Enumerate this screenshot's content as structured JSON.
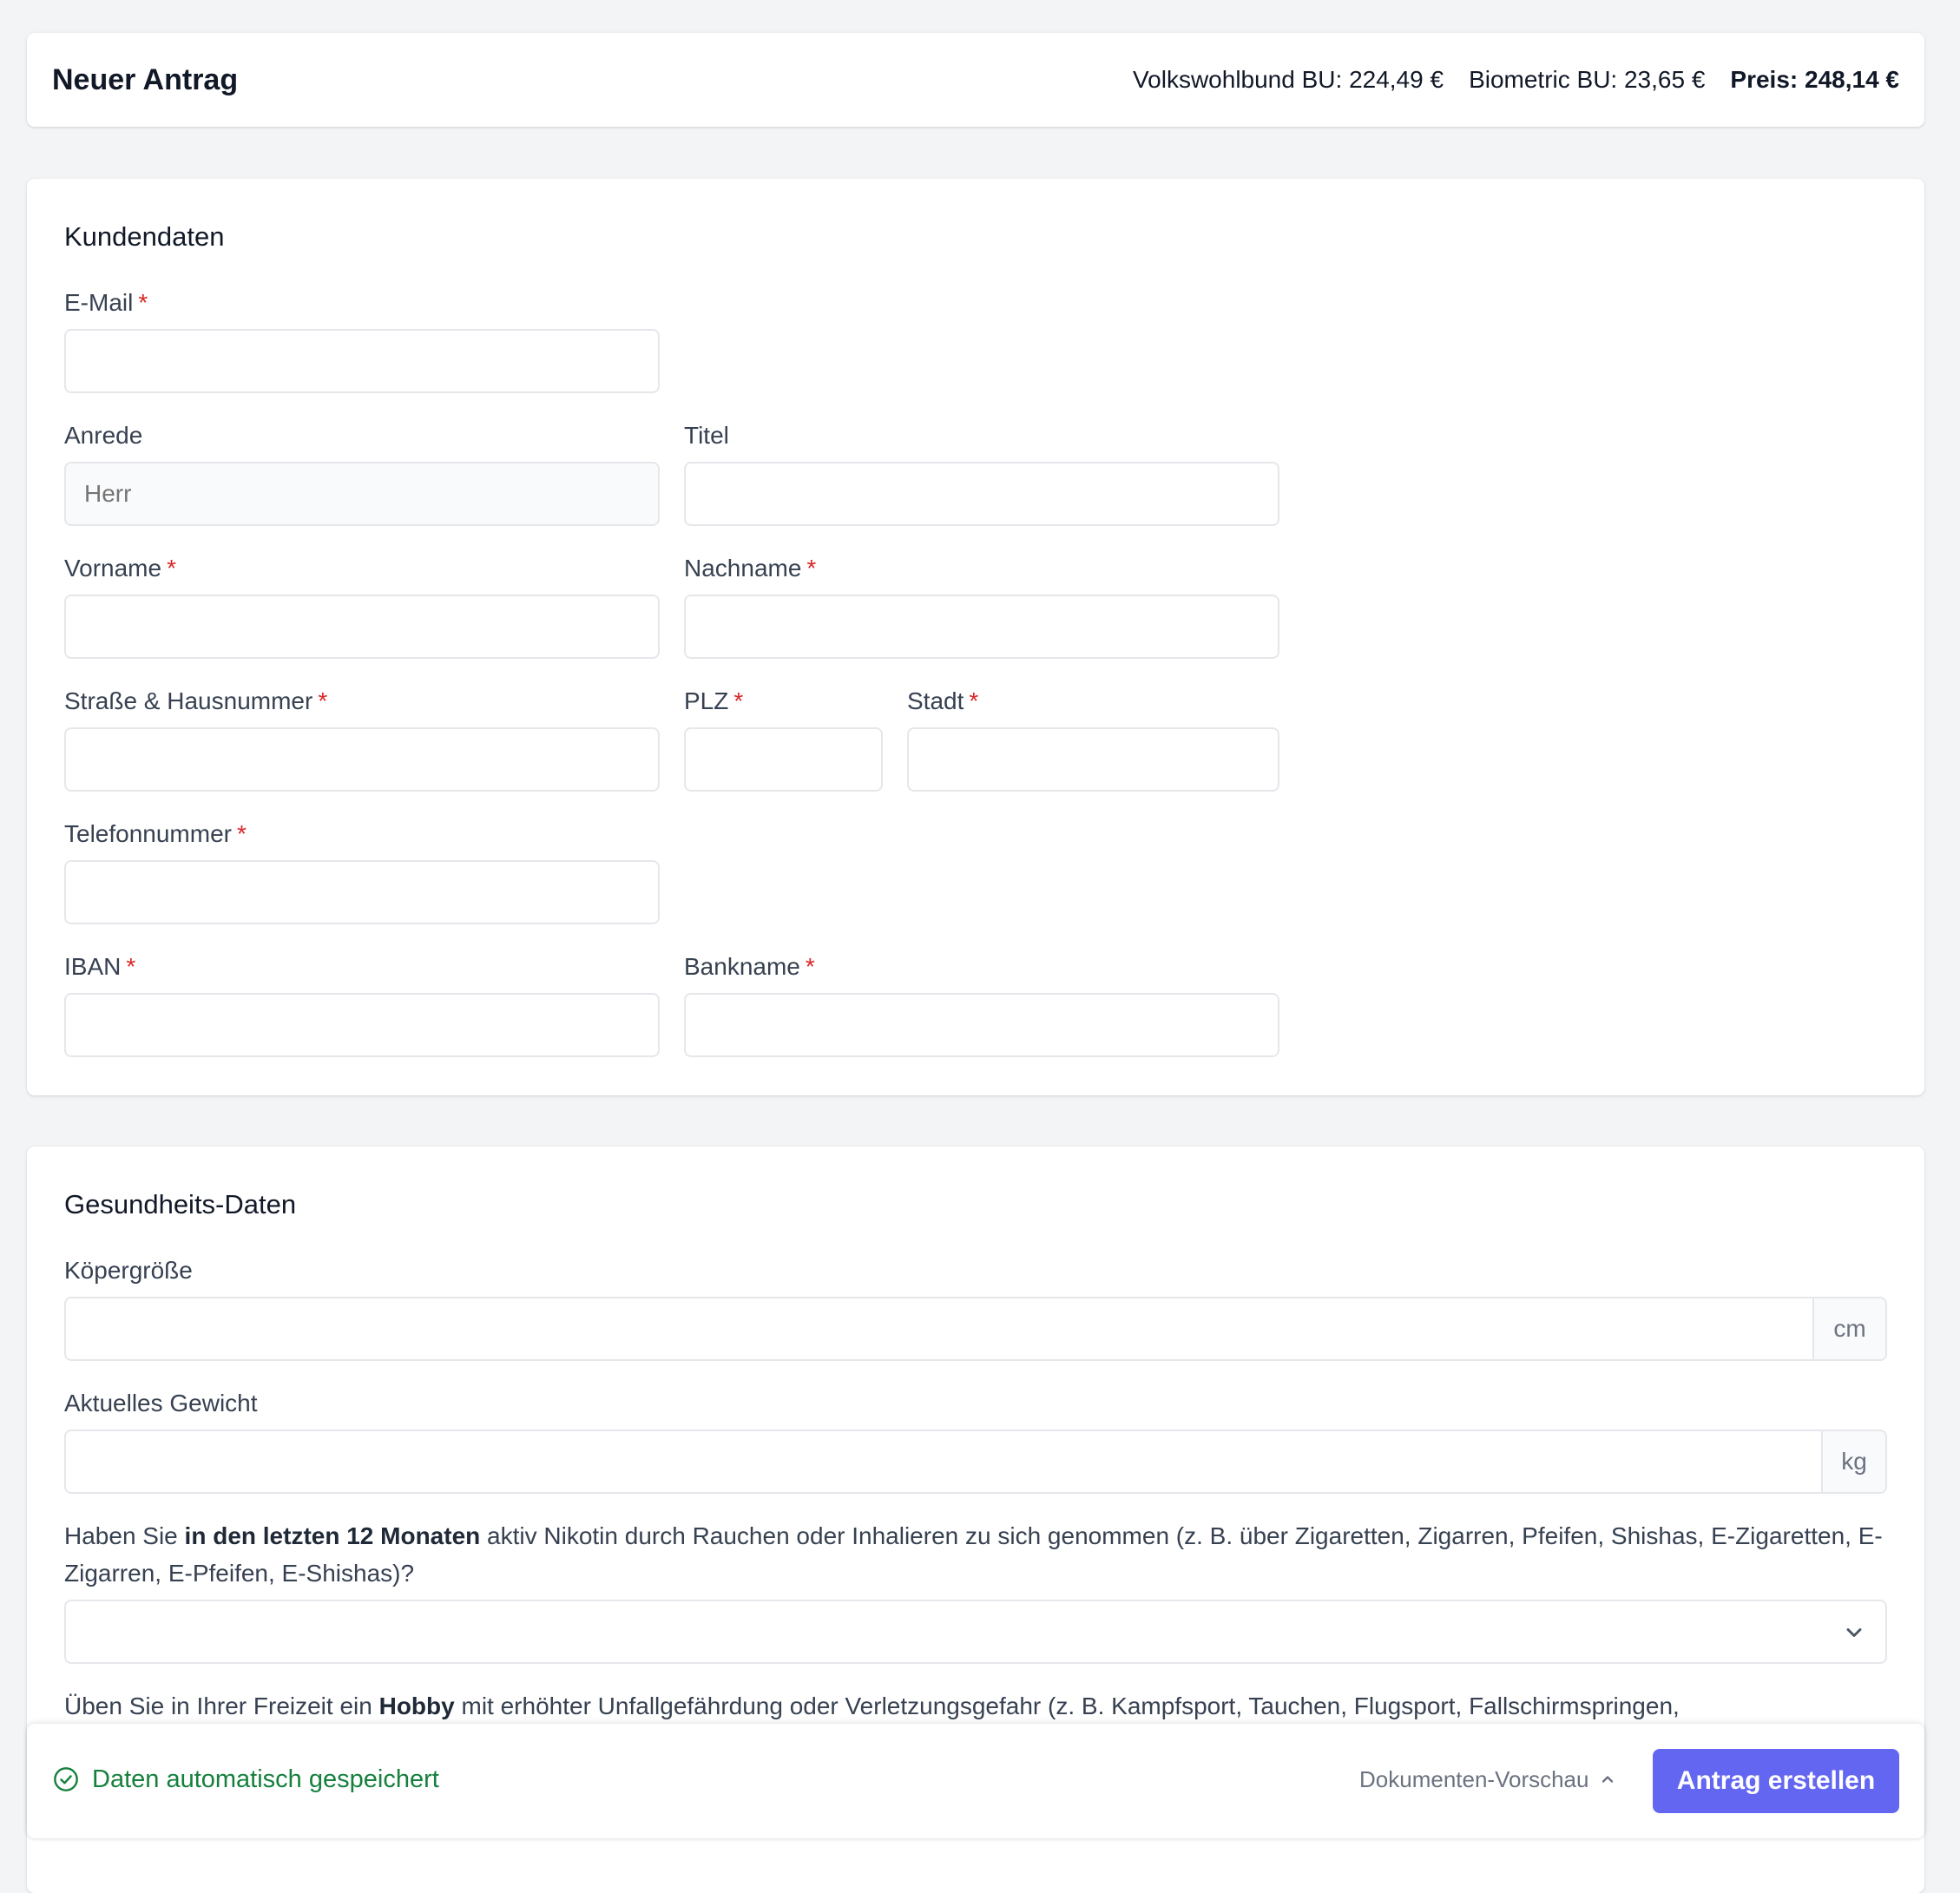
{
  "header": {
    "title": "Neuer Antrag",
    "volkswohlbund": "Volkswohlbund BU: 224,49 €",
    "biometric": "Biometric BU: 23,65 €",
    "total": "Preis: 248,14 €"
  },
  "kundendaten": {
    "title": "Kundendaten",
    "required_marker": "*",
    "email": {
      "label": "E-Mail",
      "value": ""
    },
    "anrede": {
      "label": "Anrede",
      "placeholder": "Herr"
    },
    "titel": {
      "label": "Titel",
      "value": ""
    },
    "vorname": {
      "label": "Vorname",
      "value": ""
    },
    "nachname": {
      "label": "Nachname",
      "value": ""
    },
    "strasse": {
      "label": "Straße & Hausnummer",
      "value": ""
    },
    "plz": {
      "label": "PLZ",
      "value": ""
    },
    "stadt": {
      "label": "Stadt",
      "value": ""
    },
    "telefon": {
      "label": "Telefonnummer",
      "value": ""
    },
    "iban": {
      "label": "IBAN",
      "value": ""
    },
    "bankname": {
      "label": "Bankname",
      "value": ""
    }
  },
  "gesundheit": {
    "title": "Gesundheits-Daten",
    "koerpergroesse": {
      "label": "Köpergröße",
      "unit": "cm",
      "value": ""
    },
    "gewicht": {
      "label": "Aktuelles Gewicht",
      "unit": "kg",
      "value": ""
    },
    "q_nikotin": {
      "before": "Haben Sie ",
      "bold": "in den letzten 12 Monaten",
      "after": " aktiv Nikotin durch Rauchen oder Inhalieren zu sich genommen (z. B. über Zigaretten, Zigarren, Pfeifen, Shishas, E-Zigaretten, E-Zigarren, E-Pfeifen, E-Shishas)?",
      "selected": ""
    },
    "q_hobby": {
      "before": "Üben Sie in Ihrer Freizeit ein ",
      "bold": "Hobby",
      "after": " mit erhöhter Unfallgefährdung oder Verletzungsgefahr (z. B. Kampfsport, Tauchen, Flugsport, Fallschirmspringen,"
    }
  },
  "footer": {
    "saved_status": "Daten automatisch gespeichert",
    "preview_label": "Dokumenten-Vorschau",
    "submit_label": "Antrag erstellen"
  },
  "colors": {
    "accent": "#6366f1",
    "success": "#15803d",
    "required": "#dc2626",
    "background": "#f3f4f6"
  }
}
